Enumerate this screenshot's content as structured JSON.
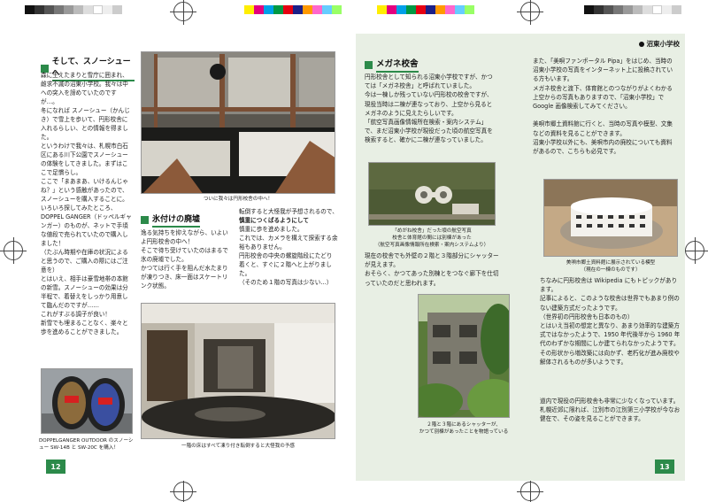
{
  "left_page": {
    "section1": {
      "title": "そして、スノーシューへ",
      "body": "森に生えたまりと雪庁に囲まれ、雌求不滅の沼東小学校。我々は中への突入を諦めていたのですが…。\n冬になれば スノーシュー（かんじき）で雪上を歩いて、円形校舎に入れるらしい、との情報を得ました。\nというわけで我々は、札幌市白石区にある川下公園でスノーシューの体験をしてきました。まずはここで足慣らし。\nここで「まあまあ、いけるんじゃね？」という感触があったので、スノーシューを購入することに。いろいろ探してみたところ、DOPPEL GANGER（ドッペルギャンガー）のものが、ネットで手頃な値段で売られていたので購入しました！\n（たぶん時期や在庫の状況によると思うので、ご購入の際にはご注意を）\nとはいえ、相手は豪雪地帯の本館の新雪。スノーシューの効果は分半程で、着替えをしっかり用意して臨んだのですが……\nこれがすぶる調子が良い！\n新雪でも埋まることなく、楽々と歩を進めることができました。"
    },
    "photo1_caption": "ついに我々は円形校舎の中へ！",
    "section2": {
      "title": "氷付けの廃墟",
      "col1": "逸る気持ちを抑えながら、いよいよ円形校舎の中へ！\nそこで待ち受けていたのはまるで氷の廃墟でした。\nかつては行く手を阻んだ水たまりが凍りつき、床一面はスケートリンク状態。",
      "col2_a": "転倒すると大怪我が予想されるので、",
      "col2_b": "慎重につくばるようにして",
      "col2_c": "慎重に歩を進めました。\nこれでは、カメラを構えて探索する余裕もありません。\n円形校舎の中央の螺旋階段にたどり着くと、すぐに２階へと上がりました。\n（そのため１階の写真は少ない…）"
    },
    "photo3_caption": "一階の床はすべて凍り付き転倒すると大怪我の予感",
    "snowshoe_caption": "DOPPELGANGER OUTDOOR のスノーシュー SW-14B と SW-20C を購入！",
    "page_number": "12"
  },
  "right_page": {
    "tag": "沼東小学校",
    "section1": {
      "title": "メガネ校舎",
      "body1": "円形校舎として知られる沼東小学校ですが、かつては「メガネ校舎」と呼ばれていました。\n今は一棟しか残っていない円形校の校舎ですが、現役当時は二棟が連なっており、上空から見るとメガネのように見えたらしいです。\n「航空写真画像情報所在検索・案内システム」で、まだ沼東小学校が現役だった頃の航空写真を検索すると、確かに二棟が連なっていました。",
      "col2": "また、「美唄ファンポータル Pipa」をはじめ、当時の沼東小学校の写真をインターネット上に投稿されている方もいます。\nメガネ校舎と渡下、体育館とのつながりがよくわかる上空からの写真もありますので、「沼東小学校」で Google 画像検索してみてください。\n\n美唄市郷土資料館に行くと、当時の写真や模型、文集などの資料を見ることができます。\n沼東小学校以外にも、美唄市内の廃校についても資料があるので、こちらも必見です。"
    },
    "aerial_caption": "「めがね校舎」だった頃の航空写真\n校舎と体育館の間には別棟があった\n（航空写真画像情報所在検索・案内システムより）",
    "model_caption": "美唄市郷土資料館に展示されている模型\n（現在の一棟のものです）",
    "mid_text": "現在の校舎でも外壁の２階と３階部分にシャッターが見えます。\nおそらく、かつてあった別棟とをつなぐ廊下を仕切っていたのだと思われます。",
    "ruin_caption": "２階と３階にあるシャッターが、\nかつて別棟があったことを物語っている",
    "col2_bottom_a": "ちなみに円形校舎は Wikipedia にもトピックがあります。\n記事によると、このような校舎は世界でもあまり例のない建築方式だったようです。\n（世界初の円形校舎も日本のもの）\nとはいえ当初の想定と異なり、あまり効率的な建築方式ではなかったようで、1950 年代後半から 1960 年代のわずかな期間にしか建てられなかったようです。\nその形状から増改築には向かず、老朽化が進み廃校や解体されるものが多いようです。",
    "col2_bottom_b": "道内で現役の円形校舎も非常に少なくなっています。\n札幌近郊に限れば、江別市の江別第三小学校が今なお健在で、その姿を見ることができます。",
    "page_number": "13"
  },
  "colors": {
    "accent": "#2c8a4a",
    "right_bg": "#e8efe4"
  }
}
